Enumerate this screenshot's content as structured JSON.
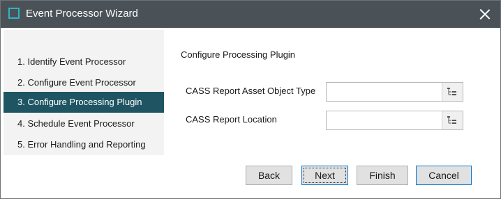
{
  "window": {
    "title": "Event Processor Wizard",
    "icon": "app-window-icon",
    "close_icon": "close-icon"
  },
  "steps": [
    {
      "label": "1. Identify Event Processor",
      "active": false
    },
    {
      "label": "2. Configure Event Processor",
      "active": false
    },
    {
      "label": "3. Configure Processing Plugin",
      "active": true
    },
    {
      "label": "4. Schedule Event Processor",
      "active": false
    },
    {
      "label": "5. Error Handling and Reporting",
      "active": false
    }
  ],
  "main": {
    "section_title": "Configure Processing Plugin",
    "fields": [
      {
        "label": "CASS Report Asset Object Type",
        "value": "",
        "browse_icon": "tree-browse-icon"
      },
      {
        "label": "CASS Report Location",
        "value": "",
        "browse_icon": "tree-browse-icon"
      }
    ]
  },
  "buttons": {
    "back": "Back",
    "next": "Next",
    "finish": "Finish",
    "cancel": "Cancel"
  },
  "colors": {
    "titlebar": "#4a5257",
    "accent": "#2eb3c6",
    "active_step": "#1f5563",
    "focus_border": "#0078d7"
  }
}
